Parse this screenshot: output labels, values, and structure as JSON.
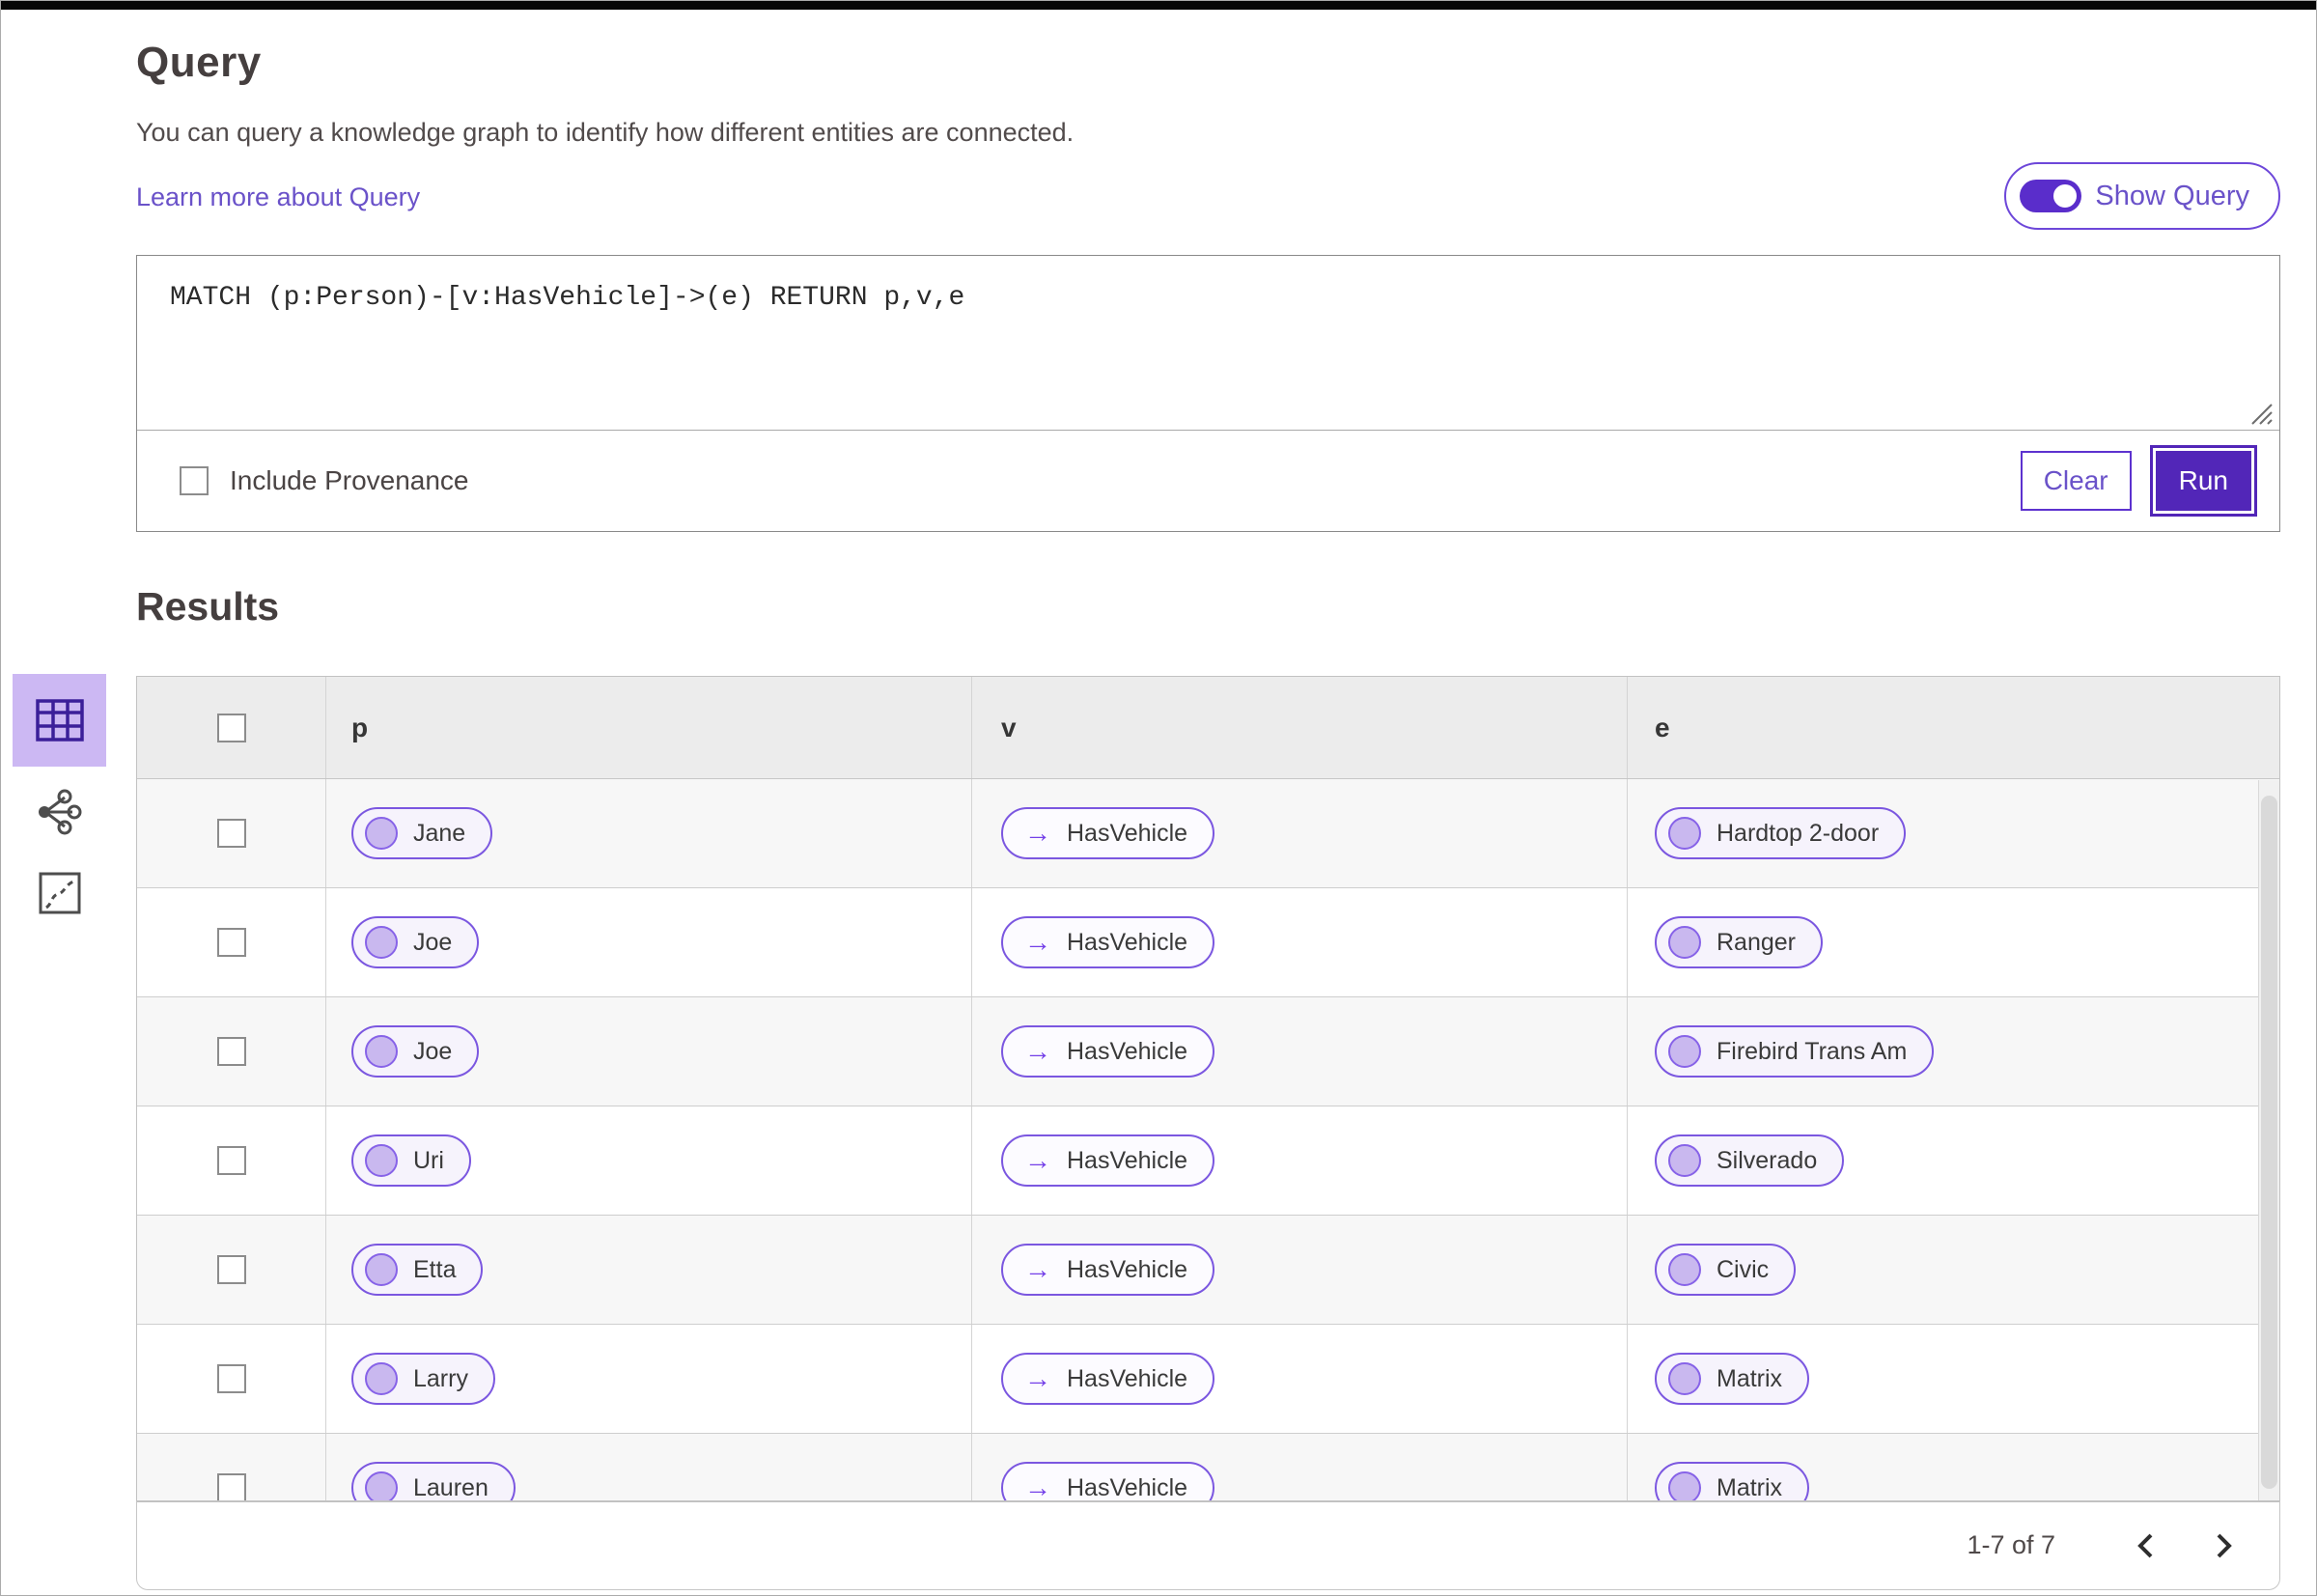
{
  "colors": {
    "accent_purple": "#5226b8",
    "link_purple": "#6a52c9",
    "pill_border_purple": "#7b57e0",
    "pill_fill": "#f6f3fc",
    "selected_view_bg": "#ccb8f3",
    "header_row_bg": "#ececec",
    "alt_row_bg": "#f7f7f7"
  },
  "query": {
    "title": "Query",
    "description": "You can query a knowledge graph to identify how different entities are connected.",
    "learn_more_link": "Learn more about Query",
    "show_query_toggle": {
      "label": "Show Query",
      "state": "on"
    },
    "editor_text": "MATCH (p:Person)-[v:HasVehicle]->(e) RETURN p,v,e",
    "include_provenance": {
      "label": "Include Provenance",
      "checked": false
    },
    "clear_button": "Clear",
    "run_button": "Run"
  },
  "results": {
    "title": "Results",
    "views": [
      {
        "name": "table-view",
        "icon": "table-icon",
        "selected": true
      },
      {
        "name": "graph-view",
        "icon": "graph-icon",
        "selected": false
      },
      {
        "name": "map-view",
        "icon": "map-icon",
        "selected": false
      }
    ],
    "table": {
      "columns": [
        "p",
        "v",
        "e"
      ],
      "edge_arrow": "→",
      "rows": [
        {
          "p": "Jane",
          "v": "HasVehicle",
          "e": "Hardtop 2-door"
        },
        {
          "p": "Joe",
          "v": "HasVehicle",
          "e": "Ranger"
        },
        {
          "p": "Joe",
          "v": "HasVehicle",
          "e": "Firebird Trans Am"
        },
        {
          "p": "Uri",
          "v": "HasVehicle",
          "e": "Silverado"
        },
        {
          "p": "Etta",
          "v": "HasVehicle",
          "e": "Civic"
        },
        {
          "p": "Larry",
          "v": "HasVehicle",
          "e": "Matrix"
        },
        {
          "p": "Lauren",
          "v": "HasVehicle",
          "e": "Matrix"
        }
      ]
    },
    "pagination": {
      "range_label": "1-7 of 7",
      "prev_icon": "chevron-left",
      "next_icon": "chevron-right"
    }
  }
}
